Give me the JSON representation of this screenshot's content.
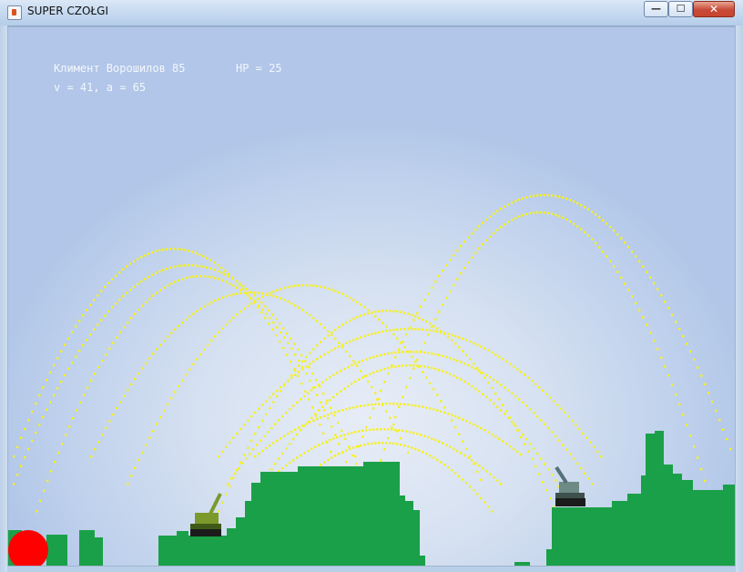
{
  "window": {
    "title": "SUPER CZOŁGI",
    "minimize_glyph": "—",
    "maximize_glyph": "☐",
    "close_glyph": "✕"
  },
  "hud": {
    "player_name": "Климент Ворошилов 85",
    "hp": "HP = 25",
    "stats": "v = 41, a = 65"
  },
  "colors": {
    "sky": "#c9d8ef",
    "terrain": "#1aa048",
    "trajectory": "#f7f020",
    "ball": "#ff0000",
    "tank_player": "#7c9a2c",
    "tank_enemy": "#6d8a84"
  }
}
